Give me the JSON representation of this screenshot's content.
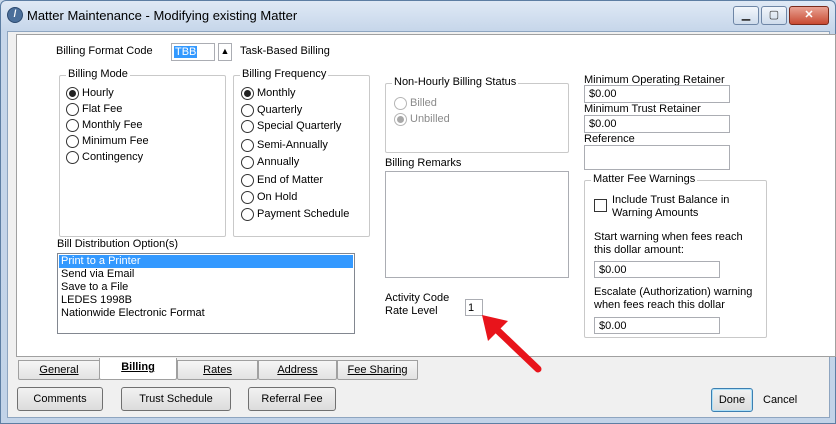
{
  "window": {
    "title": "Matter Maintenance - Modifying existing Matter",
    "app_icon": "app-logo-icon"
  },
  "billing_format": {
    "label": "Billing Format Code",
    "value": "TBB",
    "description": "Task-Based Billing"
  },
  "billing_mode": {
    "legend": "Billing Mode",
    "options": [
      "Hourly",
      "Flat Fee",
      "Monthly Fee",
      "Minimum Fee",
      "Contingency"
    ],
    "selected": "Hourly"
  },
  "billing_frequency": {
    "legend": "Billing Frequency",
    "options": [
      "Monthly",
      "Quarterly",
      "Special Quarterly",
      "Semi-Annually",
      "Annually",
      "End of Matter",
      "On Hold",
      "Payment Schedule"
    ],
    "selected": "Monthly"
  },
  "non_hourly_status": {
    "legend": "Non-Hourly Billing Status",
    "options": [
      "Billed",
      "Unbilled"
    ],
    "selected": "Unbilled"
  },
  "billing_remarks": {
    "label": "Billing Remarks",
    "value": ""
  },
  "bill_distribution": {
    "label": "Bill Distribution Option(s)",
    "items": [
      "Print to a Printer",
      "Send via Email",
      "Save to a File",
      "LEDES 1998B",
      "Nationwide Electronic Format"
    ],
    "selected": "Print to a Printer"
  },
  "activity_code": {
    "label_line1": "Activity Code",
    "label_line2": "Rate Level",
    "value": "1"
  },
  "retainers": {
    "min_operating_label": "Minimum Operating Retainer",
    "min_operating_value": "$0.00",
    "min_trust_label": "Minimum Trust Retainer",
    "min_trust_value": "$0.00",
    "reference_label": "Reference",
    "reference_value": ""
  },
  "fee_warnings": {
    "legend": "Matter Fee Warnings",
    "include_trust_line1": "Include Trust Balance in",
    "include_trust_line2": "Warning Amounts",
    "include_trust_checked": false,
    "start_line1": "Start warning when fees reach",
    "start_line2": "this dollar amount:",
    "start_value": "$0.00",
    "escalate_line1": "Escalate (Authorization)  warning",
    "escalate_line2": "when fees reach this dollar",
    "escalate_value": "$0.00"
  },
  "tabs": [
    "General",
    "Billing",
    "Rates",
    "Address",
    "Fee Sharing"
  ],
  "active_tab": "Billing",
  "buttons": {
    "comments": "Comments",
    "trust_schedule": "Trust Schedule",
    "referral_fee": "Referral Fee",
    "done": "Done",
    "cancel": "Cancel"
  },
  "annotation": {
    "icon": "red-arrow-icon",
    "color": "#e8141b"
  },
  "colors": {
    "selection": "#3399ff",
    "title_close": "#c84a32"
  }
}
